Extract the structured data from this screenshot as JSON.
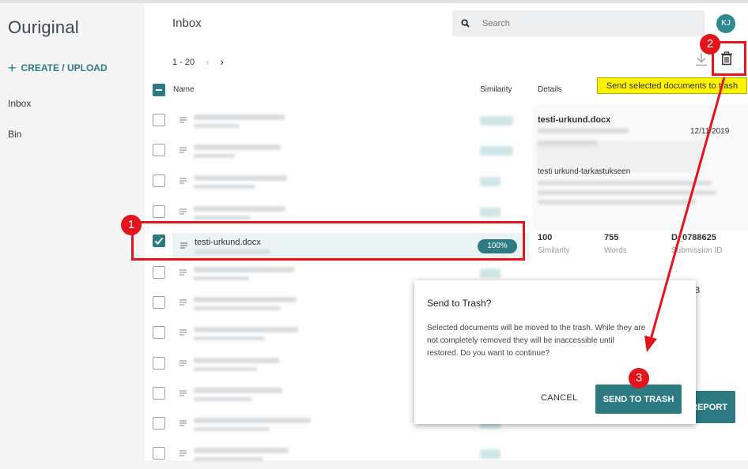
{
  "app": {
    "logo": "Ouriginal"
  },
  "sidebar": {
    "create_label": "CREATE / UPLOAD",
    "items": [
      {
        "label": "Inbox"
      },
      {
        "label": "Bin"
      }
    ]
  },
  "header": {
    "title": "Inbox",
    "search_placeholder": "Search",
    "avatar_initials": "KJ"
  },
  "pager": {
    "range": "1 - 20",
    "prev": "‹",
    "next": "›"
  },
  "table": {
    "headers": {
      "name": "Name",
      "similarity": "Similarity",
      "details": "Details"
    },
    "selected_row": {
      "name": "testi-urkund.docx",
      "similarity": "100%"
    }
  },
  "details": {
    "doc_title": "testi-urkund.docx",
    "date": "12/11/2019",
    "course_title": "testi urkund-tarkastukseen",
    "stats": [
      {
        "value": "100",
        "label": "Similarity"
      },
      {
        "value": "755",
        "label": "Words"
      },
      {
        "value": "D_0788625",
        "label": "Submission ID"
      }
    ],
    "partial_text": "B",
    "report_button": "REPORT"
  },
  "tooltip": {
    "text": "Send selected documents to trash"
  },
  "dialog": {
    "title": "Send to Trash?",
    "line1": "Selected documents will be moved to the trash. While they are",
    "line2": "not completely removed they will be inaccessible until",
    "line3": "restored. Do you want to continue?",
    "cancel": "CANCEL",
    "confirm": "SEND TO TRASH"
  },
  "annotations": {
    "step1": "1",
    "step2": "2",
    "step3": "3"
  },
  "colors": {
    "accent": "#2d7a83",
    "annotation": "#e4141c",
    "tooltip": "#fff200"
  }
}
